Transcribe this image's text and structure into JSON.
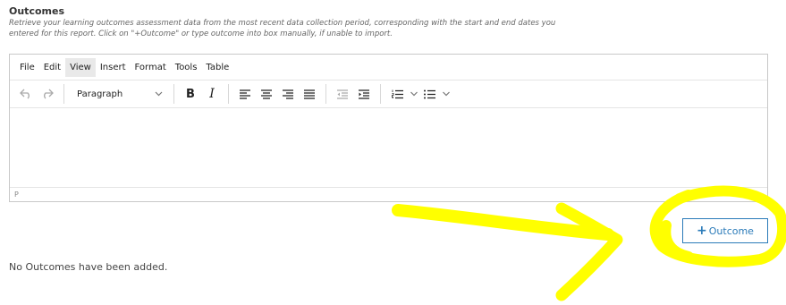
{
  "section": {
    "title": "Outcomes",
    "help": "Retrieve your learning outcomes assessment data from the most recent data collection period, corresponding with the start and end dates you entered for this report. Click on \"+Outcome\" or type outcome into box manually, if unable to import."
  },
  "editor": {
    "menus": [
      {
        "label": "File"
      },
      {
        "label": "Edit"
      },
      {
        "label": "View",
        "active": true
      },
      {
        "label": "Insert"
      },
      {
        "label": "Format"
      },
      {
        "label": "Tools"
      },
      {
        "label": "Table"
      }
    ],
    "toolbar": {
      "block_format": "Paragraph",
      "bold_label": "B",
      "italic_label": "I",
      "icons": [
        "undo-icon",
        "redo-icon",
        "chevron-down-icon",
        "bold-icon",
        "italic-icon",
        "align-left-icon",
        "align-center-icon",
        "align-right-icon",
        "align-justify-icon",
        "outdent-icon",
        "indent-icon",
        "numbered-list-icon",
        "bullet-list-icon"
      ]
    },
    "content": "",
    "status_path": "P"
  },
  "add_button": {
    "plus": "+",
    "label": "Outcome"
  },
  "empty_message": "No Outcomes have been added.",
  "colors": {
    "accent": "#2b7bb9",
    "highlight": "#ffff00"
  }
}
